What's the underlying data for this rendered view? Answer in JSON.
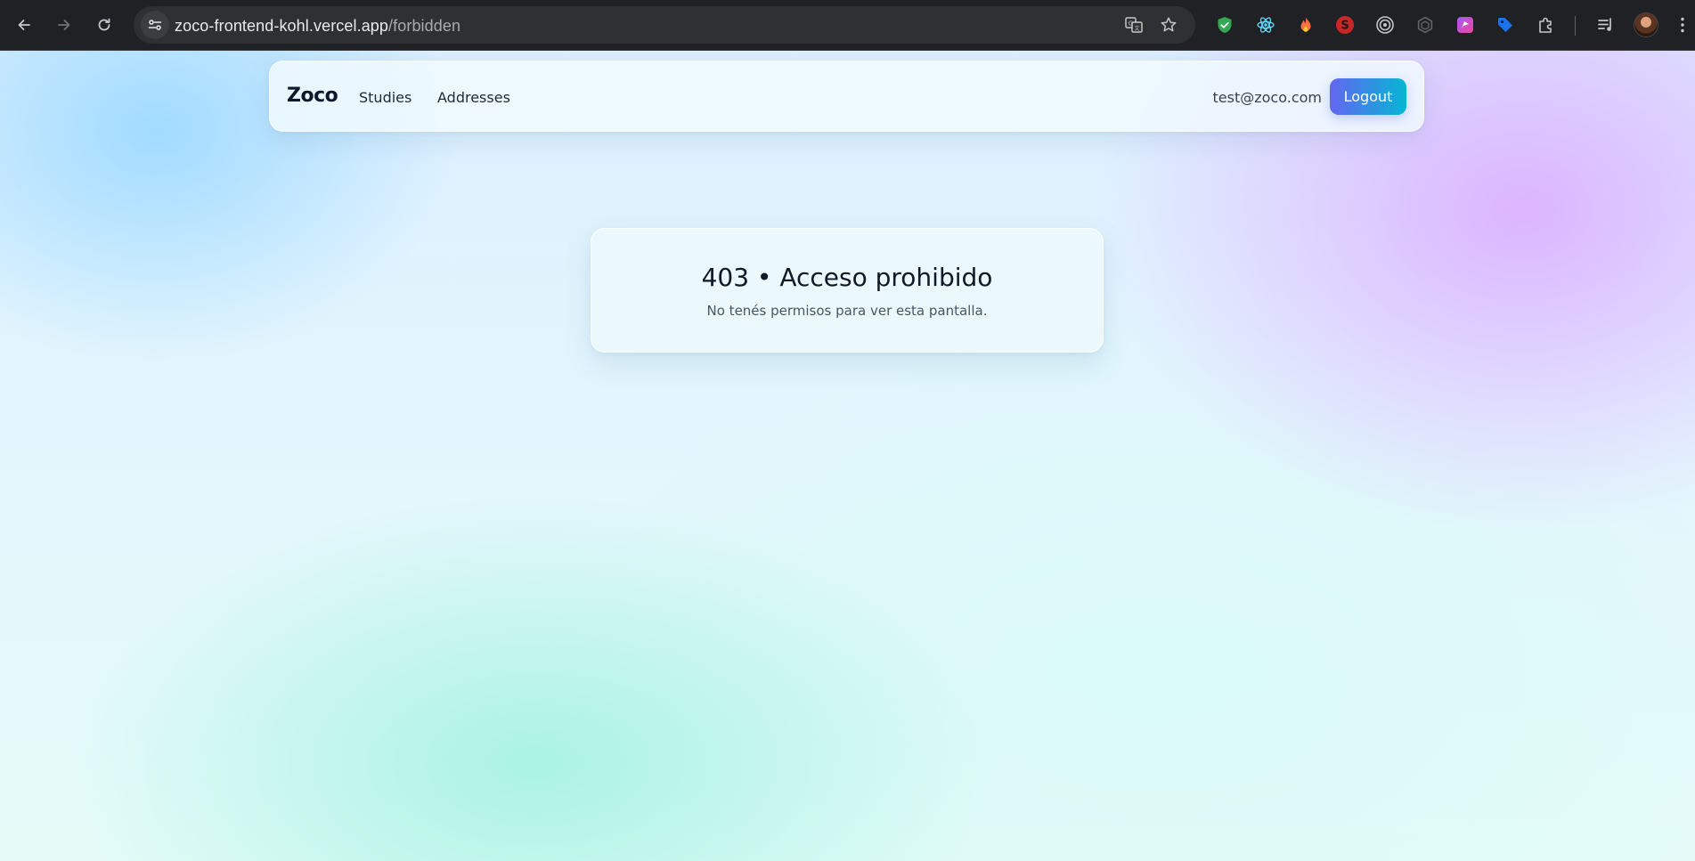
{
  "browser": {
    "url_host": "zoco-frontend-kohl.vercel.app",
    "url_path": "/forbidden",
    "icons": {
      "back": "arrow-left-icon",
      "forward": "arrow-right-icon",
      "reload": "reload-icon",
      "site_info": "site-settings-icon",
      "translate": "translate-icon",
      "bookmark": "star-icon"
    },
    "extensions": [
      "shield-check-icon",
      "react-devtools-icon",
      "fire-icon",
      "seo-icon",
      "target-icon",
      "hexagon-icon",
      "purple-app-icon",
      "tag-icon",
      "puzzle-icon",
      "media-control-icon"
    ]
  },
  "navbar": {
    "brand": "Zoco",
    "links": [
      "Studies",
      "Addresses"
    ],
    "user_email": "test@zoco.com",
    "logout_label": "Logout",
    "accent_gradient": [
      "#6366f1",
      "#06b6d4"
    ]
  },
  "error": {
    "title": "403 • Acceso prohibido",
    "message": "No tenés permisos para ver esta pantalla."
  }
}
